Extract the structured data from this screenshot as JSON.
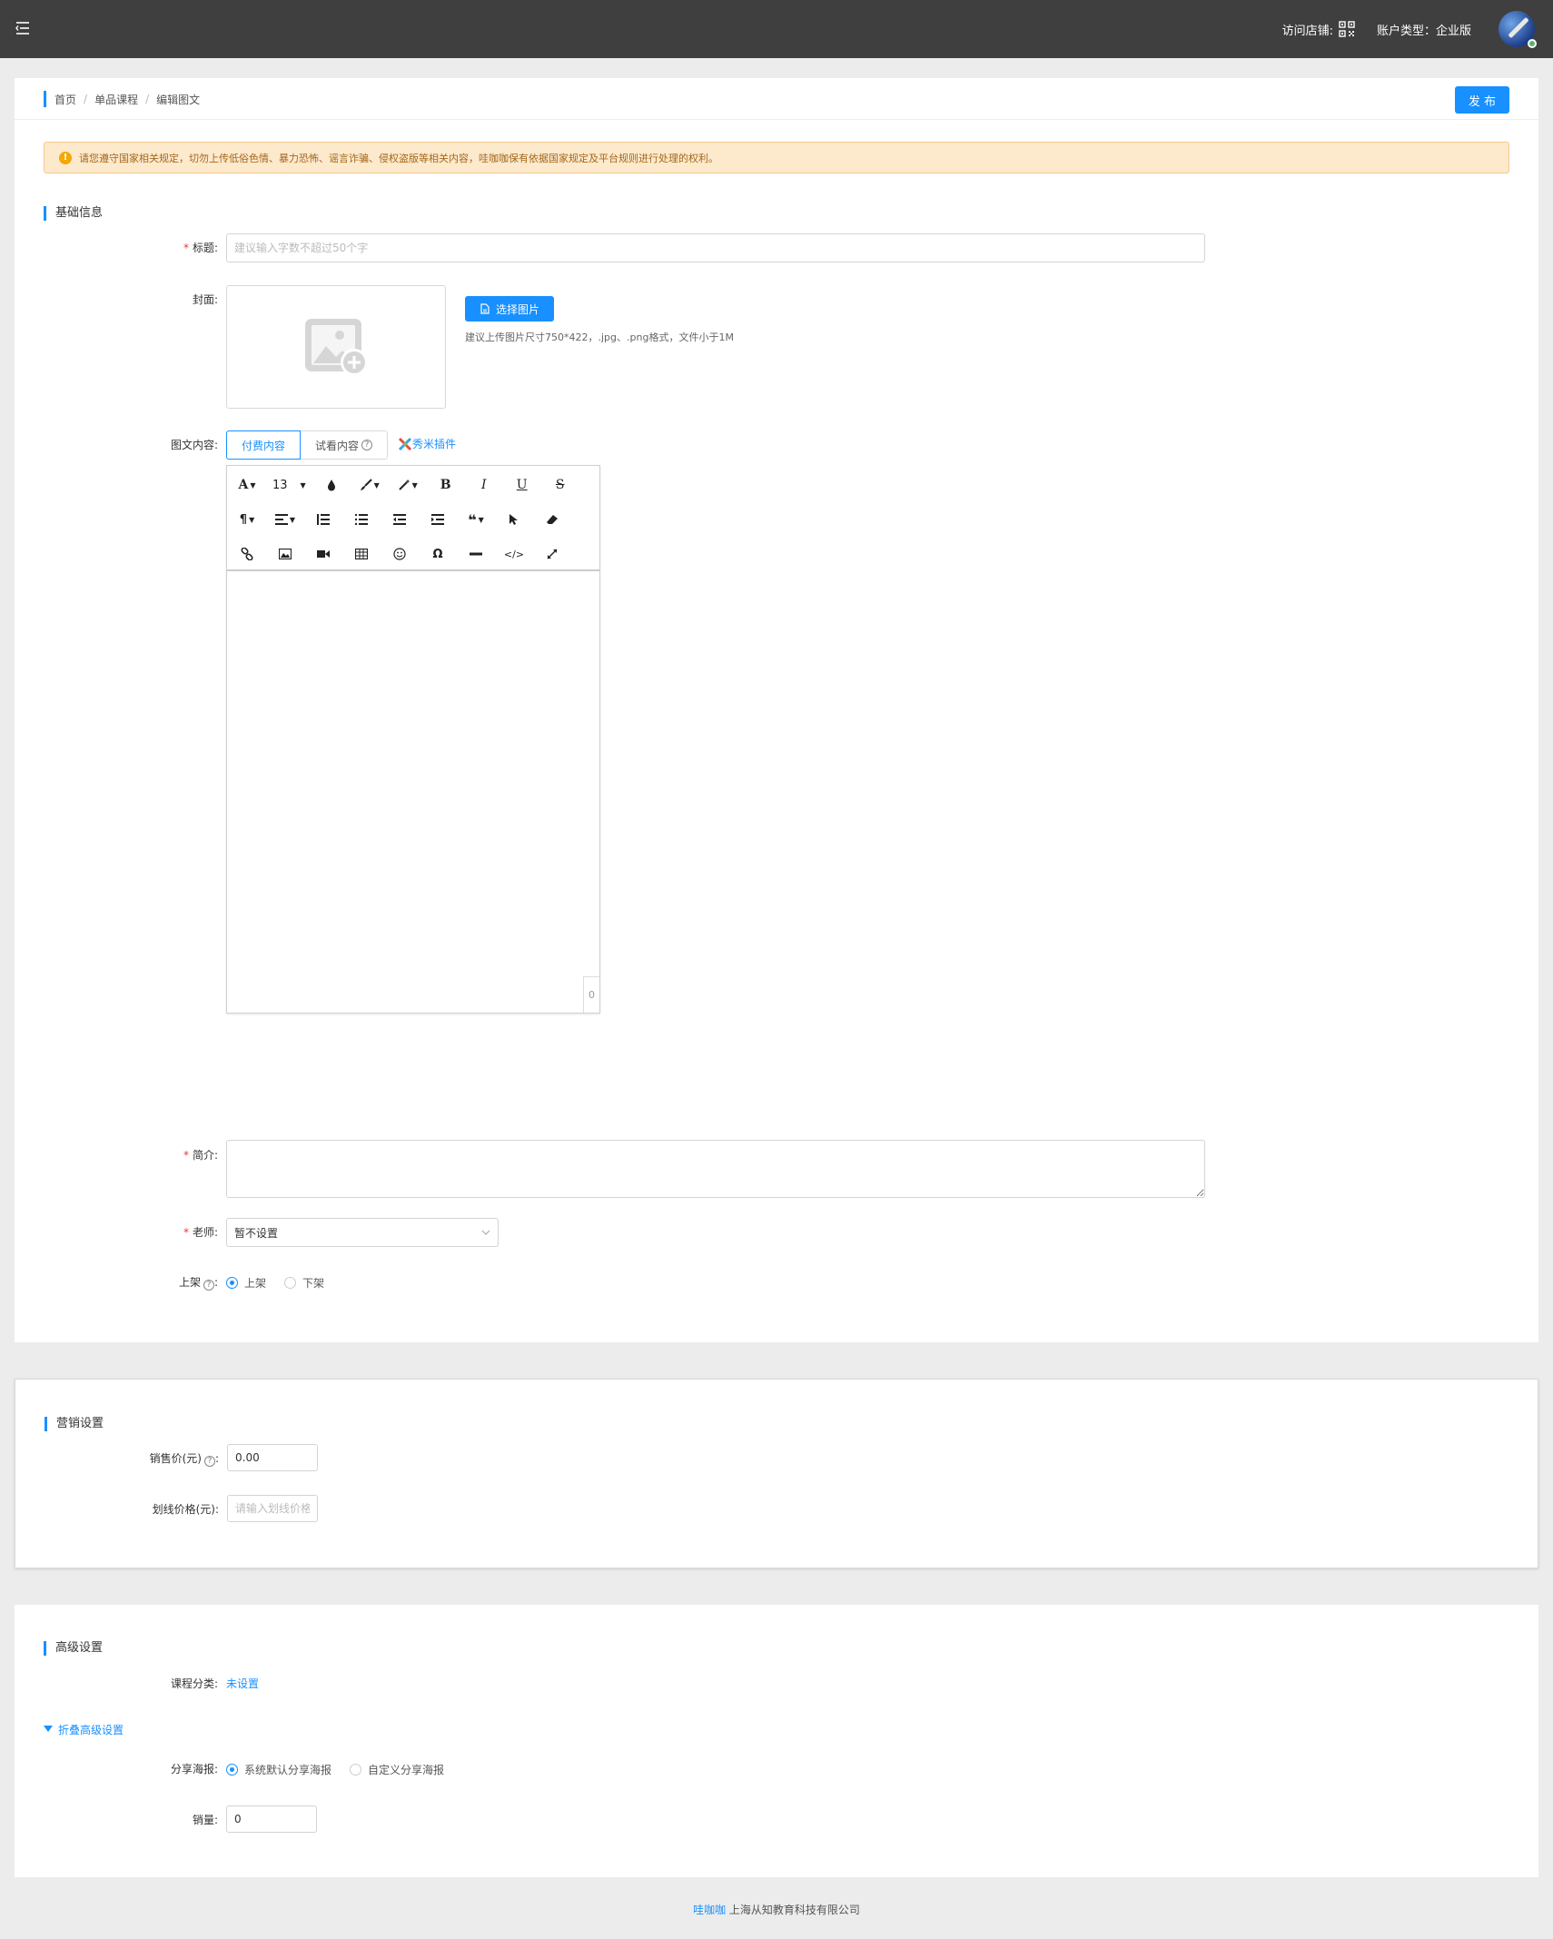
{
  "header": {
    "visit_shop": "访问店铺:",
    "account_type": "账户类型：企业版"
  },
  "breadcrumb": [
    "首页",
    "单品课程",
    "编辑图文"
  ],
  "publish_label": "发 布",
  "notice": "请您遵守国家相关规定，切勿上传低俗色情、暴力恐怖、谣言诈骗、侵权盗版等相关内容，哇咖咖保有依据国家规定及平台规则进行处理的权利。",
  "basic": {
    "section": "基础信息",
    "title_label": "标题",
    "title_placeholder": "建议输入字数不超过50个字",
    "cover_label": "封面",
    "select_image": "选择图片",
    "cover_hint": "建议上传图片尺寸750*422，.jpg、.png格式，文件小于1M",
    "content_label": "图文内容",
    "tab_paid": "付费内容",
    "tab_trial": "试看内容",
    "plugin": "秀米插件",
    "font_size": "13",
    "char_count": "0",
    "intro_label": "简介",
    "teacher_label": "老师",
    "teacher_value": "暂不设置",
    "shelf_label": "上架",
    "shelf_on": "上架",
    "shelf_off": "下架"
  },
  "marketing": {
    "section": "营销设置",
    "price_label": "销售价(元)",
    "price_value": "0.00",
    "strike_label": "划线价格(元)",
    "strike_placeholder": "请输入划线价格"
  },
  "advanced": {
    "section": "高级设置",
    "category_label": "课程分类",
    "category_value": "未设置",
    "collapse": "折叠高级设置",
    "poster_label": "分享海报",
    "poster_default": "系统默认分享海报",
    "poster_custom": "自定义分享海报",
    "sales_label": "销量",
    "sales_value": "0"
  },
  "footer": {
    "brand": "哇咖咖",
    "company": "上海从知教育科技有限公司"
  },
  "colors": {
    "primary": "#1890ff",
    "topbar": "#3f3f3f",
    "notice_bg": "#fde9cc",
    "required": "#e53935"
  }
}
